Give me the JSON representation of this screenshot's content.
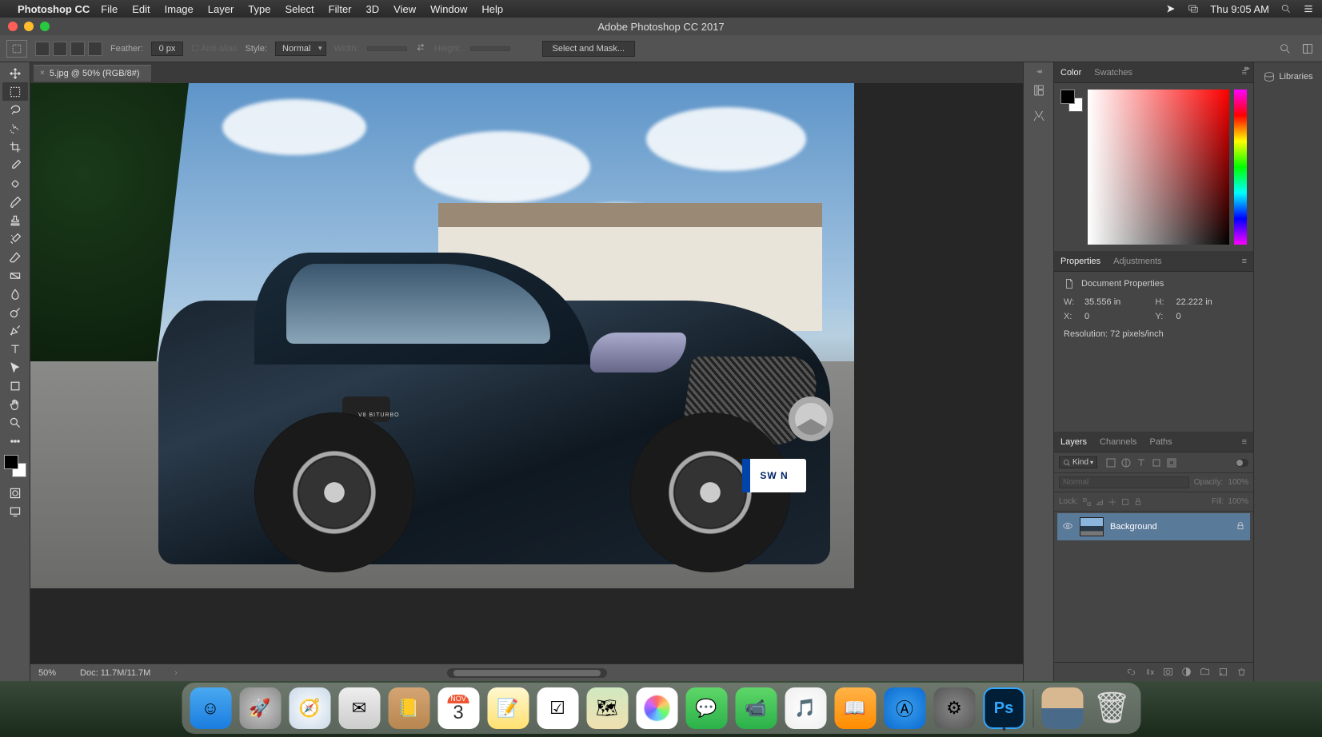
{
  "menubar": {
    "app_name": "Photoshop CC",
    "items": [
      "File",
      "Edit",
      "Image",
      "Layer",
      "Type",
      "Select",
      "Filter",
      "3D",
      "View",
      "Window",
      "Help"
    ],
    "clock": "Thu 9:05 AM"
  },
  "window": {
    "title": "Adobe Photoshop CC 2017"
  },
  "optbar": {
    "feather_label": "Feather:",
    "feather_value": "0 px",
    "antialias_label": "Anti-alias",
    "style_label": "Style:",
    "style_value": "Normal",
    "width_label": "Width:",
    "height_label": "Height:",
    "mask_button": "Select and Mask..."
  },
  "tab": {
    "close": "×",
    "label": "5.jpg @ 50% (RGB/8#)"
  },
  "canvas": {
    "plate": "SW N",
    "badge": "V8 BITURBO"
  },
  "statusbar": {
    "zoom": "50%",
    "doc": "Doc: 11.7M/11.7M",
    "chev": "›"
  },
  "panels": {
    "color_tab": "Color",
    "swatches_tab": "Swatches",
    "props_tab": "Properties",
    "adjust_tab": "Adjustments",
    "props_title": "Document Properties",
    "w_label": "W:",
    "w_value": "35.556 in",
    "h_label": "H:",
    "h_value": "22.222 in",
    "x_label": "X:",
    "x_value": "0",
    "y_label": "Y:",
    "y_value": "0",
    "res_label": "Resolution: 72 pixels/inch",
    "layers_tab": "Layers",
    "channels_tab": "Channels",
    "paths_tab": "Paths",
    "kind_label": "Kind",
    "blend_mode": "Normal",
    "opacity_label": "Opacity:",
    "opacity_value": "100%",
    "lock_label": "Lock:",
    "fill_label": "Fill:",
    "fill_value": "100%",
    "layer_name": "Background",
    "menu_glyph": "≡"
  },
  "libraries": {
    "label": "Libraries"
  },
  "dock": {
    "apps": [
      {
        "name": "finder",
        "bg": "linear-gradient(#4aa9f0,#1a7de0)",
        "glyph": "☺"
      },
      {
        "name": "launchpad",
        "bg": "radial-gradient(#ccc,#888)",
        "glyph": "🚀"
      },
      {
        "name": "safari",
        "bg": "radial-gradient(#fff,#c8d8e8)",
        "glyph": "🧭"
      },
      {
        "name": "mail",
        "bg": "linear-gradient(#eee,#ccc)",
        "glyph": "✉"
      },
      {
        "name": "contacts",
        "bg": "linear-gradient(#d4a574,#b8864f)",
        "glyph": "📒"
      },
      {
        "name": "calendar",
        "bg": "#fff",
        "glyph": ""
      },
      {
        "name": "notes",
        "bg": "linear-gradient(#fff8d0,#ffe070)",
        "glyph": "📝"
      },
      {
        "name": "reminders",
        "bg": "#fff",
        "glyph": "☑"
      },
      {
        "name": "maps",
        "bg": "linear-gradient(#d0e8c0,#f0e0b0)",
        "glyph": "🗺"
      },
      {
        "name": "photos",
        "bg": "#fff",
        "glyph": "❀"
      },
      {
        "name": "messages",
        "bg": "linear-gradient(#5fd768,#2bb14a)",
        "glyph": "💬"
      },
      {
        "name": "facetime",
        "bg": "linear-gradient(#5fd768,#2bb14a)",
        "glyph": "📹"
      },
      {
        "name": "itunes",
        "bg": "radial-gradient(#fff,#eee)",
        "glyph": "🎵"
      },
      {
        "name": "ibooks",
        "bg": "linear-gradient(#ffb347,#ff8c00)",
        "glyph": "📖"
      },
      {
        "name": "appstore",
        "bg": "radial-gradient(#3aa0f0,#0a6ad0)",
        "glyph": "Ⓐ"
      },
      {
        "name": "preferences",
        "bg": "radial-gradient(#888,#555)",
        "glyph": "⚙"
      },
      {
        "name": "photoshop",
        "bg": "linear-gradient(#001e36,#001e36)",
        "glyph": "Ps"
      }
    ],
    "cal_month": "NOV",
    "cal_day": "3",
    "right": [
      {
        "name": "desktop-preview",
        "bg": "linear-gradient(#d8b890 0 50%,#4a6a8a 50% 100%)",
        "glyph": ""
      },
      {
        "name": "trash",
        "bg": "#fff",
        "glyph": "🗑"
      }
    ]
  }
}
